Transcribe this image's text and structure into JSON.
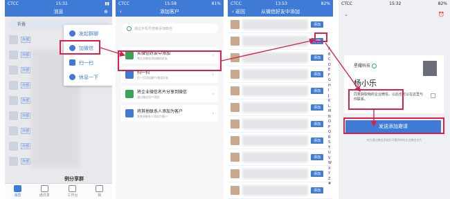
{
  "screen1": {
    "status": {
      "carrier": "CTCC",
      "time": "15:31"
    },
    "title": "消息",
    "fold_label": "折叠",
    "badge": "外部",
    "menu": [
      "发起群聊",
      "加微信",
      "扫一扫",
      "休息一下"
    ],
    "share_label": "例分享群",
    "tabs": [
      "消息",
      "通讯录",
      "工作台",
      "我"
    ]
  },
  "screen2": {
    "status": {
      "carrier": "CTCC",
      "time": "15:58",
      "battery": "81%"
    },
    "title": "添加客户",
    "search_placeholder": "通过手机号搜索添加微信",
    "options": [
      {
        "title": "从微信好友中添加",
        "sub": "将企业微信添加微信好友"
      },
      {
        "title": "扫一扫",
        "sub": "扫一扫添加客户/微信好友"
      },
      {
        "title": "将企业微信名片分享到微信",
        "sub": "通过微信用户添加"
      },
      {
        "title": "将其他联系人添加为客户",
        "sub": "将其他联系人添加为客户"
      }
    ]
  },
  "screen3": {
    "status": {
      "carrier": "CTCC",
      "time": "13:53",
      "battery": "82%"
    },
    "back": "返回",
    "title": "从微信好友中添加",
    "add_label": "添加",
    "index": [
      "A",
      "B",
      "C",
      "D",
      "E",
      "F",
      "G",
      "H",
      "I",
      "J",
      "K",
      "L",
      "M",
      "N",
      "O",
      "P",
      "Q",
      "R",
      "S",
      "T",
      "U",
      "V",
      "W",
      "X",
      "Y",
      "Z",
      "#"
    ]
  },
  "screen4": {
    "status": {
      "carrier": "CTCC",
      "time": "15:32",
      "battery": "82%"
    },
    "company": "星耀科技",
    "name": "杨小乐",
    "checkbox_text": "同意获取我的企业微信，以后也可以在这里与你联系。",
    "send_button": "发送添加邀请",
    "note": "对方通过微信添加后可看到你的企业微信名片"
  },
  "colors": {
    "accent": "#3e7ad6",
    "highlight": "#d6224a"
  }
}
